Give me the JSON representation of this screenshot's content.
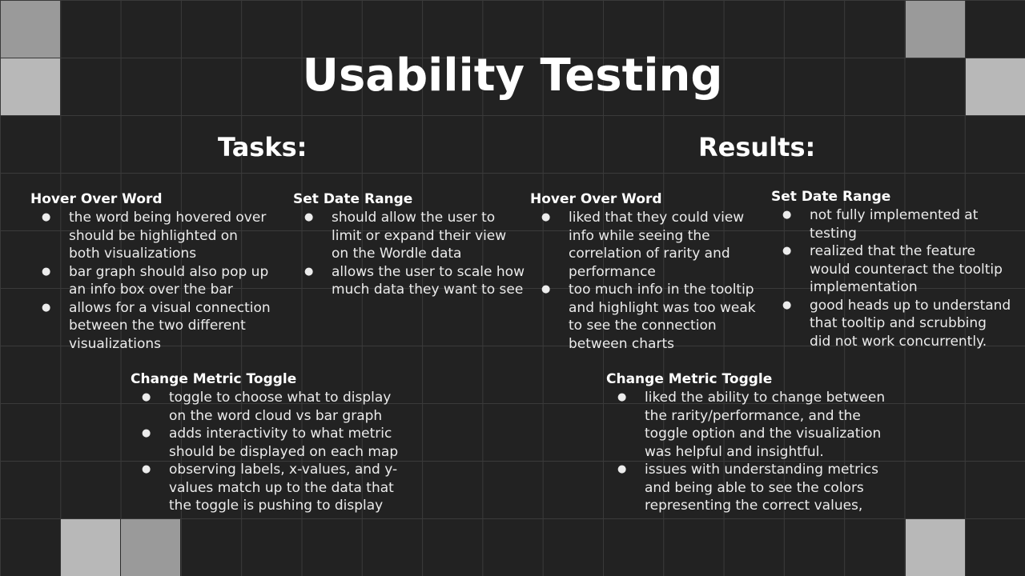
{
  "title": "Usability Testing",
  "tasks": {
    "heading": "Tasks:",
    "hover": {
      "title": "Hover Over Word",
      "items": [
        "the word being hovered over should be highlighted on both visualizations",
        "bar graph should also pop up an info  box over the bar",
        "allows for a visual connection between the two different visualizations"
      ]
    },
    "date": {
      "title": "Set Date Range",
      "items": [
        "should allow the user to limit or expand their view on the Wordle data",
        "allows the user to scale how much data they want to see"
      ]
    },
    "metric": {
      "title": "Change Metric Toggle",
      "items": [
        "toggle to choose what to display on the word cloud vs bar graph",
        "adds interactivity to what metric should be displayed on each map",
        "observing labels, x-values, and y-values match up to the data that the toggle is pushing to display"
      ]
    }
  },
  "results": {
    "heading": "Results:",
    "hover": {
      "title": "Hover Over Word",
      "items": [
        "liked that they could view info while seeing the correlation of rarity and performance",
        "too much info in the tooltip and highlight was too weak to see the connection between charts"
      ]
    },
    "date": {
      "title": "Set Date Range",
      "items": [
        "not fully implemented at testing",
        "realized that the feature would counteract the tooltip implementation",
        "good heads up to understand that tooltip and scrubbing did not work concurrently."
      ]
    },
    "metric": {
      "title": "Change Metric Toggle",
      "items": [
        "liked the ability to change between the rarity/performance, and the toggle option and the visualization was helpful and insightful.",
        "issues with understanding metrics and being able to see the colors representing the correct values,"
      ]
    }
  },
  "bullet_glyph": "●"
}
